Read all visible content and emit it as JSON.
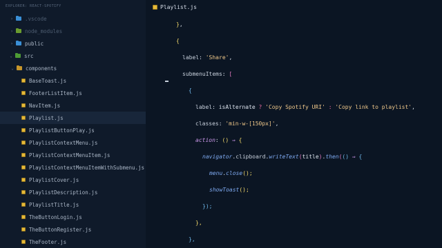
{
  "sidebar": {
    "title": "EXPLORER: REACT-SPOTIFY",
    "items": [
      {
        "label": ".vscode",
        "kind": "folder",
        "folder_color": "#3a8fd6",
        "expanded": false,
        "dim": true
      },
      {
        "label": "node_modules",
        "kind": "folder",
        "folder_color": "#6a9c2f",
        "expanded": false,
        "dim": true
      },
      {
        "label": "public",
        "kind": "folder",
        "folder_color": "#3a8fd6",
        "expanded": false
      },
      {
        "label": "src",
        "kind": "folder",
        "folder_color": "#4d9b35",
        "expanded": true
      },
      {
        "label": "components",
        "kind": "folder",
        "folder_color": "#c7962b",
        "expanded": true
      },
      {
        "label": "BaseToast.js",
        "kind": "file"
      },
      {
        "label": "FooterListItem.js",
        "kind": "file"
      },
      {
        "label": "NavItem.js",
        "kind": "file"
      },
      {
        "label": "Playlist.js",
        "kind": "file",
        "selected": true
      },
      {
        "label": "PlaylistButtonPlay.js",
        "kind": "file"
      },
      {
        "label": "PlaylistContextMenu.js",
        "kind": "file"
      },
      {
        "label": "PlaylistContextMenuItem.js",
        "kind": "file"
      },
      {
        "label": "PlaylistContextMenuItemWithSubmenu.js",
        "kind": "file"
      },
      {
        "label": "PlaylistCover.js",
        "kind": "file"
      },
      {
        "label": "PlaylistDescription.js",
        "kind": "file"
      },
      {
        "label": "PlaylistTitle.js",
        "kind": "file"
      },
      {
        "label": "TheButtonLogin.js",
        "kind": "file"
      },
      {
        "label": "TheButtonRegister.js",
        "kind": "file"
      },
      {
        "label": "TheFooter.js",
        "kind": "file"
      }
    ]
  },
  "editor": {
    "tab_label": "Playlist.js",
    "code": {
      "l1": {
        "close_brace": "}",
        "comma": ","
      },
      "l2": {
        "open_brace": "{"
      },
      "l3": {
        "key": "label",
        "colon": ": ",
        "value": "'Share'",
        "comma": ","
      },
      "l4": {
        "key": "submenuItems",
        "colon": ": ",
        "bracket": "["
      },
      "l5": {
        "open_brace": "{"
      },
      "l6": {
        "key": "label",
        "colon": ": ",
        "cond": "isAlternate",
        "q": " ? ",
        "a": "'Copy Spotify URI'",
        "c": " : ",
        "b": "'Copy link to playlist'",
        "comma": ","
      },
      "l7": {
        "key": "classes",
        "colon": ": ",
        "value": "'min-w-[150px]'",
        "comma": ","
      },
      "l8": {
        "key": "action",
        "colon": ": ",
        "params": "()",
        "arrow": " ⇒ ",
        "brace": "{"
      },
      "l9": {
        "obj": "navigator",
        "dot1": ".",
        "prop": "clipboard",
        "dot2": ".",
        "method": "writeText",
        "open": "(",
        "arg": "title",
        "close": ")",
        "dot3": ".",
        "then": "then",
        "open2": "(",
        "params": "()",
        "arrow": " ⇒ ",
        "brace": "{"
      },
      "l10": {
        "obj": "menu",
        "dot": ".",
        "method": "close",
        "call": "();"
      },
      "l11": {
        "method": "showToast",
        "call": "();"
      },
      "l12": {
        "close": "});"
      },
      "l13": {
        "close": "},"
      },
      "l14": {
        "close": "},"
      }
    }
  }
}
